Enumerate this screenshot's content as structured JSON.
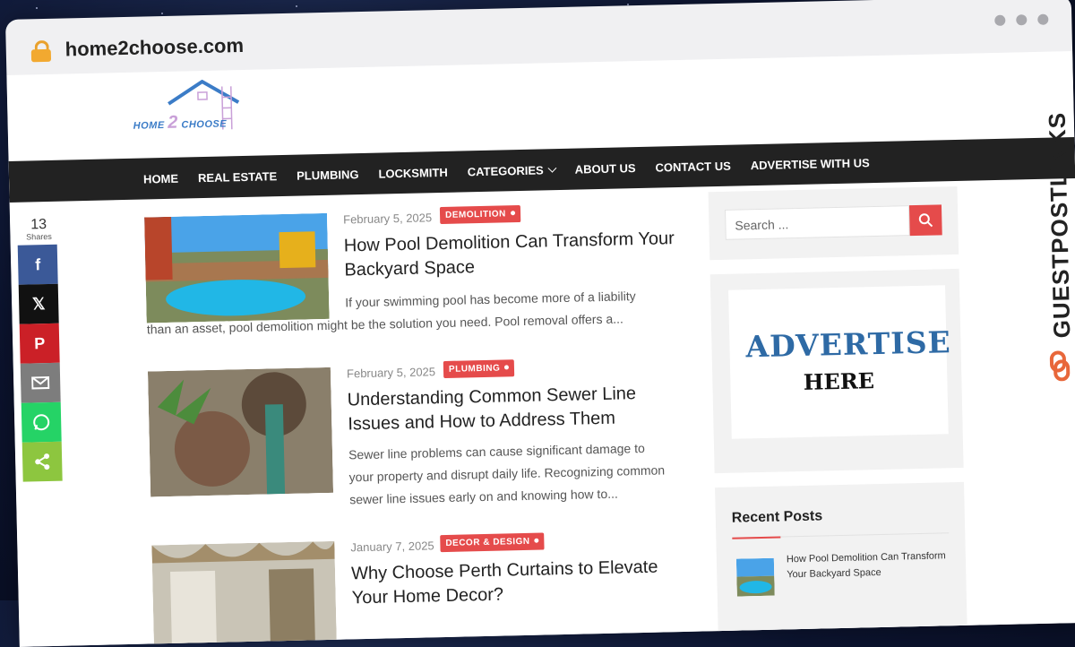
{
  "browser": {
    "url": "home2choose.com"
  },
  "logo": {
    "part1": "HOME",
    "part2": "2",
    "part3": "CHOOSE"
  },
  "nav": {
    "items": [
      "HOME",
      "REAL ESTATE",
      "PLUMBING",
      "LOCKSMITH",
      "CATEGORIES",
      "ABOUT US",
      "CONTACT US",
      "ADVERTISE WITH US"
    ]
  },
  "share": {
    "count": "13",
    "label": "Shares",
    "networks": [
      "facebook",
      "x",
      "pinterest",
      "email",
      "whatsapp",
      "share"
    ]
  },
  "posts": [
    {
      "date": "February 5, 2025",
      "category": "DEMOLITION",
      "title": "How Pool Demolition Can Transform Your Backyard Space",
      "excerpt_line1": "If your swimming pool has become more of a liability",
      "excerpt_rest": "than an asset, pool demolition might be the solution you need. Pool removal offers a..."
    },
    {
      "date": "February 5, 2025",
      "category": "PLUMBING",
      "title": "Understanding Common Sewer Line Issues and How to Address Them",
      "excerpt_line1": "Sewer line problems can cause significant damage to",
      "excerpt_rest": "your property and disrupt daily life. Recognizing common sewer line issues early on and knowing how to..."
    },
    {
      "date": "January 7, 2025",
      "category": "DECOR & DESIGN",
      "title": "Why Choose Perth Curtains to Elevate Your Home Decor?",
      "excerpt_line1": "",
      "excerpt_rest": ""
    }
  ],
  "sidebar": {
    "search_placeholder": "Search ...",
    "ad_line1": "ADVERTISE",
    "ad_line2": "HERE",
    "recent_heading": "Recent Posts",
    "recent_items": [
      "How Pool Demolition Can Transform Your Backyard Space"
    ]
  },
  "watermark": "GUESTPOSTLINKS",
  "colors": {
    "accent": "#e54b4b",
    "nav_bg": "#222222",
    "facebook": "#3b5998",
    "x": "#111111",
    "pinterest": "#cb2027",
    "email": "#7d7d7d",
    "whatsapp": "#25d366",
    "share": "#8dc63f"
  }
}
